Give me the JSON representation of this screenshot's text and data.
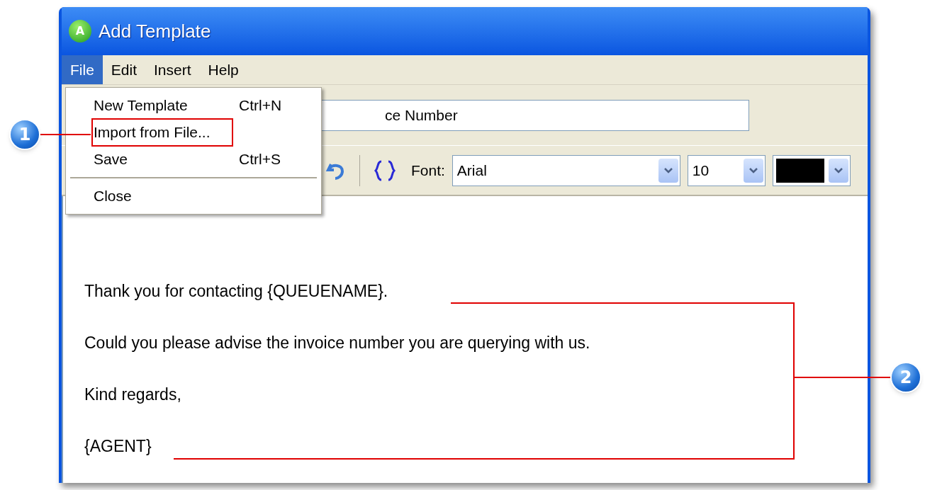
{
  "window": {
    "title": "Add Template",
    "icon_letter": "A"
  },
  "menu_bar": [
    {
      "label": "File",
      "selected": true
    },
    {
      "label": "Edit",
      "selected": false
    },
    {
      "label": "Insert",
      "selected": false
    },
    {
      "label": "Help",
      "selected": false
    }
  ],
  "file_menu": [
    {
      "kind": "item",
      "label": "New Template",
      "shortcut": "Ctrl+N",
      "highlighted": false
    },
    {
      "kind": "item",
      "label": "Import from File...",
      "highlighted": true
    },
    {
      "kind": "item",
      "label": "Save",
      "shortcut": "Ctrl+S",
      "highlighted": false
    },
    {
      "kind": "separator"
    },
    {
      "kind": "item",
      "label": "Close",
      "highlighted": false
    }
  ],
  "subject_field": {
    "value": "ce Number"
  },
  "toolbar": {
    "font_label": "Font:",
    "font": "Arial",
    "size": "10",
    "color": "#000000"
  },
  "body": [
    "Thank you for contacting {QUEUENAME}.",
    "Could you please advise the invoice number you are querying with us.",
    "Kind regards,",
    "{AGENT}"
  ],
  "callouts": [
    "1",
    "2"
  ]
}
